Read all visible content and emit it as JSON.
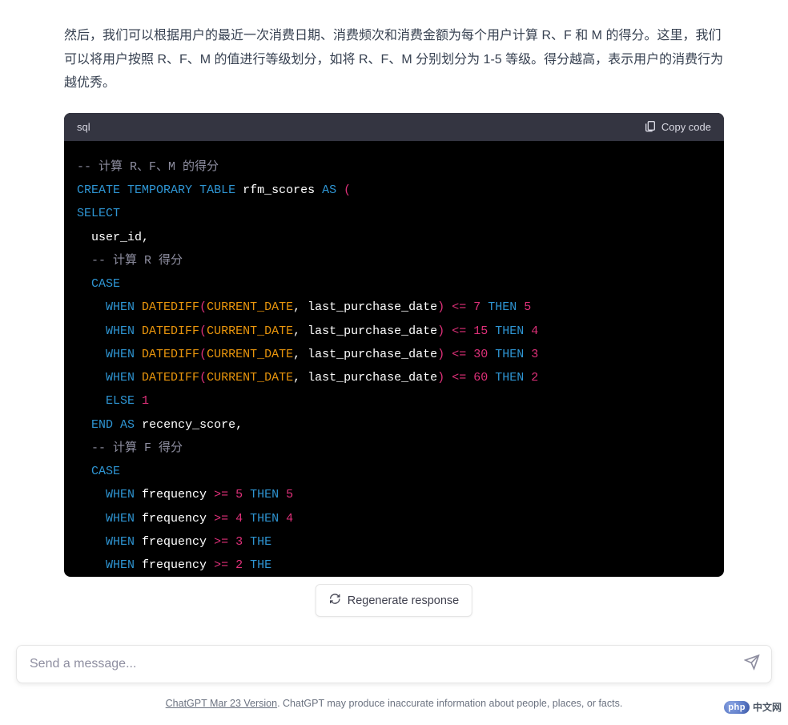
{
  "explain_text": "然后，我们可以根据用户的最近一次消费日期、消费频次和消费金额为每个用户计算 R、F 和 M 的得分。这里，我们可以将用户按照 R、F、M 的值进行等级划分，如将 R、F、M 分别划分为 1-5 等级。得分越高，表示用户的消费行为越优秀。",
  "codeblock": {
    "language": "sql",
    "copy_label": "Copy code",
    "lines": {
      "c1": "-- 计算 R、F、M 的得分",
      "kw_create": "CREATE",
      "kw_temporary": "TEMPORARY",
      "kw_table": "TABLE",
      "tbl_name": "rfm_scores",
      "kw_as": "AS",
      "brace_open": "(",
      "kw_select": "SELECT",
      "col_user_id": "user_id,",
      "c2": "-- 计算 R 得分",
      "kw_case": "CASE",
      "kw_when": "WHEN",
      "fn_datediff": "DATEDIFF",
      "fn_current_date": "CURRENT_DATE",
      "arg_last_purchase": "last_purchase_date",
      "op_lte": "<=",
      "r_v1": "7",
      "r_t1": "5",
      "r_v2": "15",
      "r_t2": "4",
      "r_v3": "30",
      "r_t3": "3",
      "r_v4": "60",
      "r_t4": "2",
      "kw_then": "THEN",
      "kw_else": "ELSE",
      "else_val": "1",
      "kw_end": "END",
      "kw_as2": "AS",
      "alias_recency": "recency_score,",
      "c3": "-- 计算 F 得分",
      "col_frequency": "frequency",
      "op_gte": ">=",
      "f_v1": "5",
      "f_t1": "5",
      "f_v2": "4",
      "f_t2": "4",
      "f_v3": "3",
      "f_t3_prefix": "THE",
      "f_v4": "2",
      "f_t4_prefix": "THE"
    }
  },
  "regen_label": "Regenerate response",
  "input_placeholder": "Send a message...",
  "footer": {
    "version": "ChatGPT Mar 23 Version",
    "disclaimer": ". ChatGPT may produce inaccurate information about people, places, or facts."
  },
  "watermark": {
    "badge": "php",
    "text": "中文网"
  }
}
